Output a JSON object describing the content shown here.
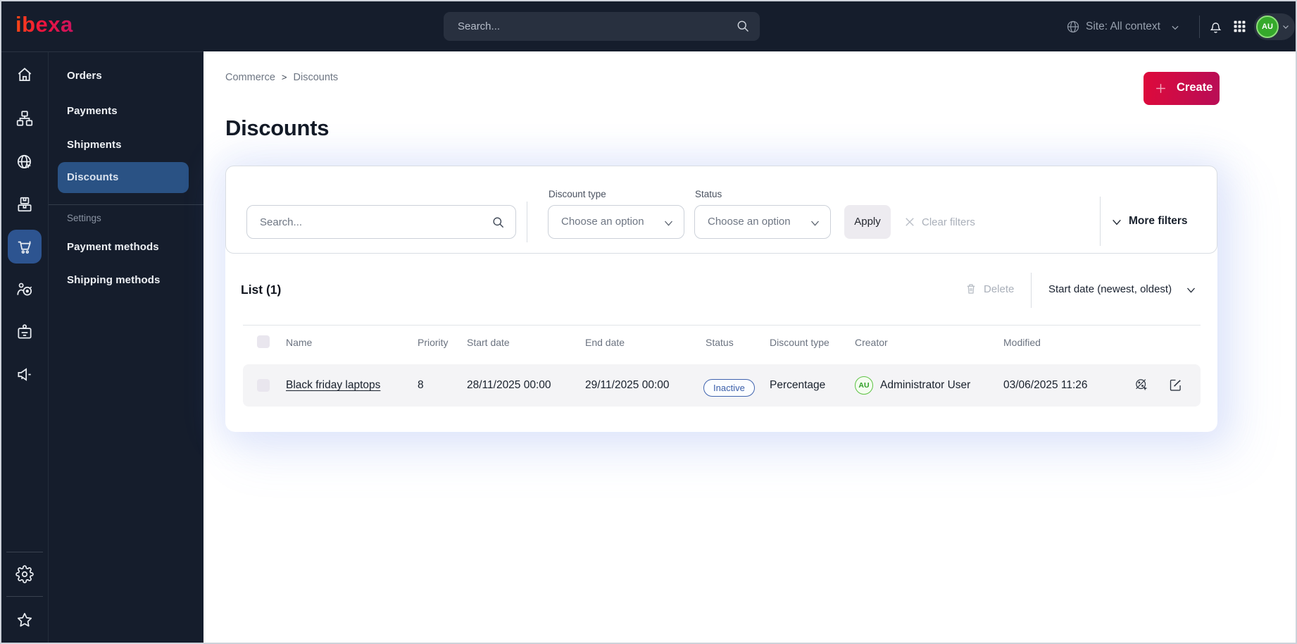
{
  "brand": {
    "logo_text": "ibexa"
  },
  "topbar": {
    "search_placeholder": "Search...",
    "site_context": "Site: All context",
    "avatar_initials": "AU"
  },
  "menu": {
    "items": {
      "orders": "Orders",
      "payments": "Payments",
      "shipments": "Shipments",
      "discounts": "Discounts"
    },
    "section_label": "Settings",
    "settings_items": {
      "payment_methods": "Payment methods",
      "shipping_methods": "Shipping methods"
    }
  },
  "breadcrumb": {
    "first": "Commerce",
    "second": "Discounts"
  },
  "page": {
    "title": "Discounts",
    "create_label": "Create"
  },
  "filters": {
    "search_placeholder": "Search...",
    "discount_type_label": "Discount type",
    "discount_type_value": "Choose an option",
    "status_label": "Status",
    "status_value": "Choose an option",
    "apply_label": "Apply",
    "clear_label": "Clear filters",
    "more_label": "More filters"
  },
  "list": {
    "title": "List (1)",
    "delete_label": "Delete",
    "sort_label": "Start date (newest, oldest)",
    "columns": [
      "Name",
      "Priority",
      "Start date",
      "End date",
      "Status",
      "Discount type",
      "Creator",
      "Modified"
    ],
    "rows": [
      {
        "name": "Black friday laptops",
        "priority": "8",
        "start": "28/11/2025 00:00",
        "end": "29/11/2025 00:00",
        "status": "Inactive",
        "type": "Percentage",
        "creator": "Administrator User",
        "creator_initials": "AU",
        "modified": "03/06/2025 11:26"
      }
    ]
  },
  "colors": {
    "topbar_bg": "#151d2c",
    "active_blue": "#2a5284",
    "brand_gradient_start": "#de0a3b",
    "brand_gradient_end": "#b80d56",
    "status_badge": "#3a5ea9",
    "avatar_green": "#35a92b"
  }
}
